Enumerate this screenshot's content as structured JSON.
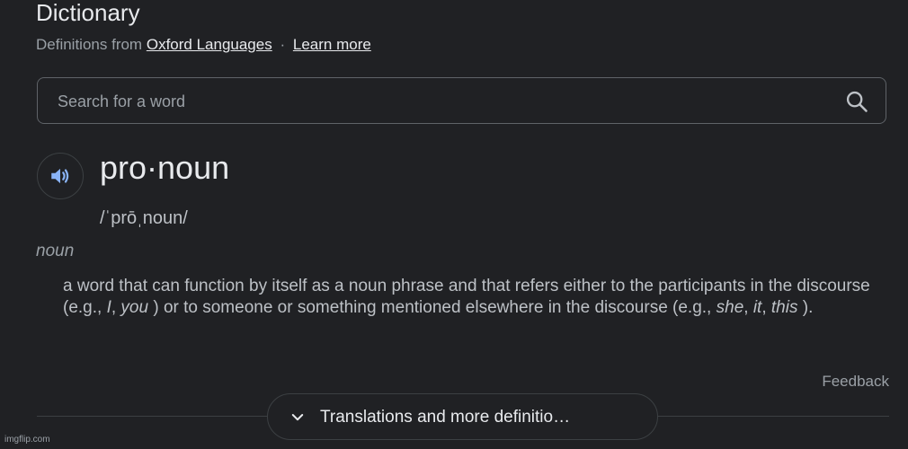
{
  "header": {
    "title": "Dictionary",
    "subtitle_prefix": "Definitions from",
    "source_link": "Oxford Languages",
    "separator": "·",
    "learn_more": "Learn more"
  },
  "search": {
    "placeholder": "Search for a word",
    "value": ""
  },
  "entry": {
    "headword": "pro·noun",
    "phonetic": "/ˈprōˌnoun/",
    "part_of_speech": "noun",
    "definition": {
      "t1": "a word that can function by itself as a noun phrase and that refers either to the participants in the discourse (e.g., ",
      "e1": "I",
      "t2": ", ",
      "e2": "you",
      "t3": " ) or to someone or something mentioned elsewhere in the discourse (e.g., ",
      "e3": "she",
      "t4": ", ",
      "e4": "it",
      "t5": ", ",
      "e5": "this",
      "t6": " )."
    }
  },
  "footer": {
    "feedback": "Feedback",
    "more_button": "Translations and more definitio…",
    "watermark": "imgflip.com"
  },
  "colors": {
    "background": "#202124",
    "text_primary": "#e8eaed",
    "text_secondary": "#9aa0a6",
    "accent_blue": "#8ab4f8"
  },
  "icons": {
    "search": "search-icon",
    "audio": "speaker-icon",
    "expand": "chevron-down-icon"
  }
}
